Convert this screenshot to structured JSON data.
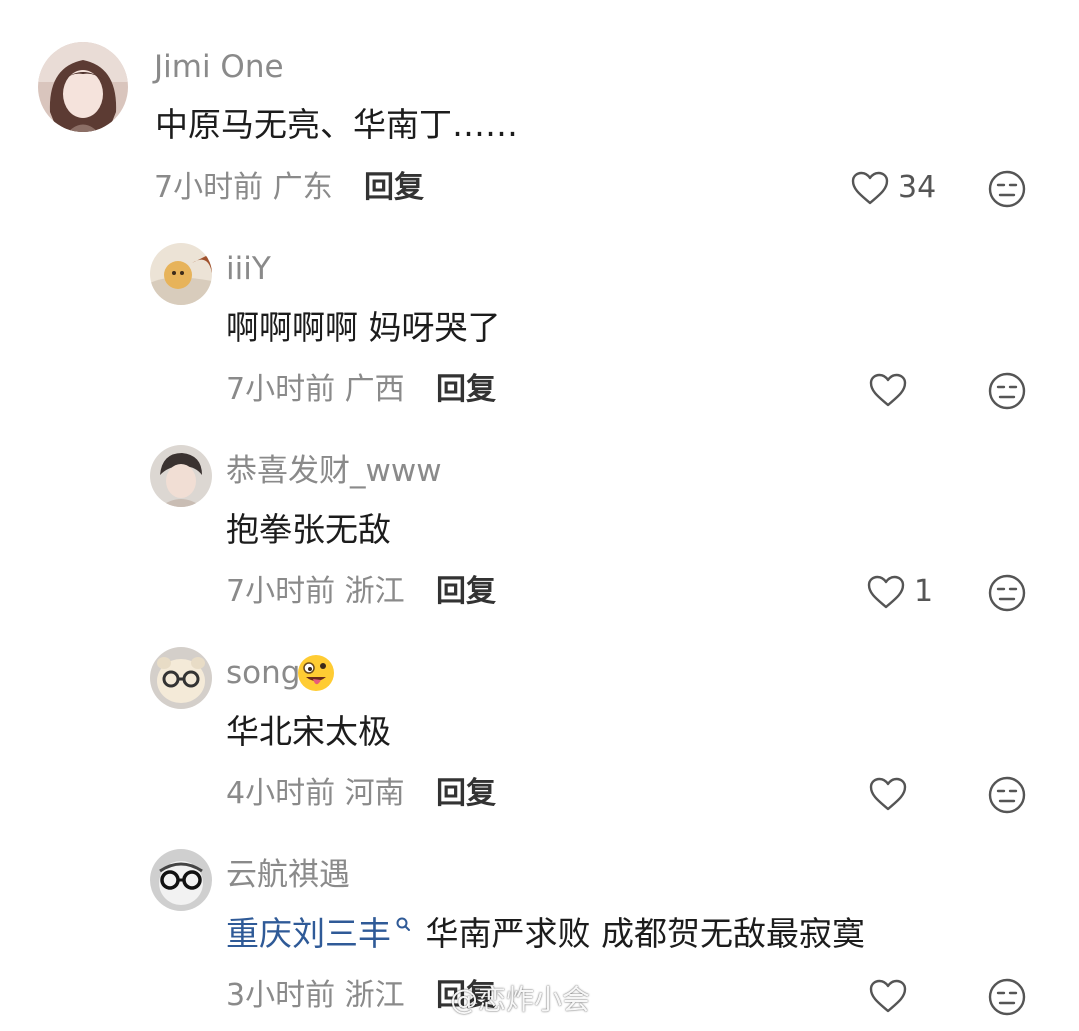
{
  "comments": [
    {
      "username": "Jimi One",
      "text": "中原马无亮、华南丁……",
      "time": "7小时前",
      "location": "广东",
      "reply_label": "回复",
      "likes": "34"
    },
    {
      "username": "iiiY",
      "text": "啊啊啊啊 妈呀哭了",
      "time": "7小时前",
      "location": "广西",
      "reply_label": "回复",
      "likes": ""
    },
    {
      "username": "恭喜发财_www",
      "text": "抱拳张无敌",
      "time": "7小时前",
      "location": "浙江",
      "reply_label": "回复",
      "likes": "1"
    },
    {
      "username": "song",
      "text": "华北宋太极",
      "time": "4小时前",
      "location": "河南",
      "reply_label": "回复",
      "likes": ""
    },
    {
      "username": "云航祺遇",
      "mention": "重庆刘三丰",
      "text": "华南严求败 成都贺无敌最寂寞",
      "time": "3小时前",
      "location": "浙江",
      "reply_label": "回复",
      "likes": ""
    }
  ],
  "watermark": "@恋炸小会",
  "colors": {
    "mention": "#2f5a97",
    "meta": "#8a8a8a"
  },
  "icons": {
    "like": "heart-outline-icon",
    "dislike": "meh-face-icon",
    "search": "search-icon",
    "emoji": "crazy-face-emoji"
  }
}
